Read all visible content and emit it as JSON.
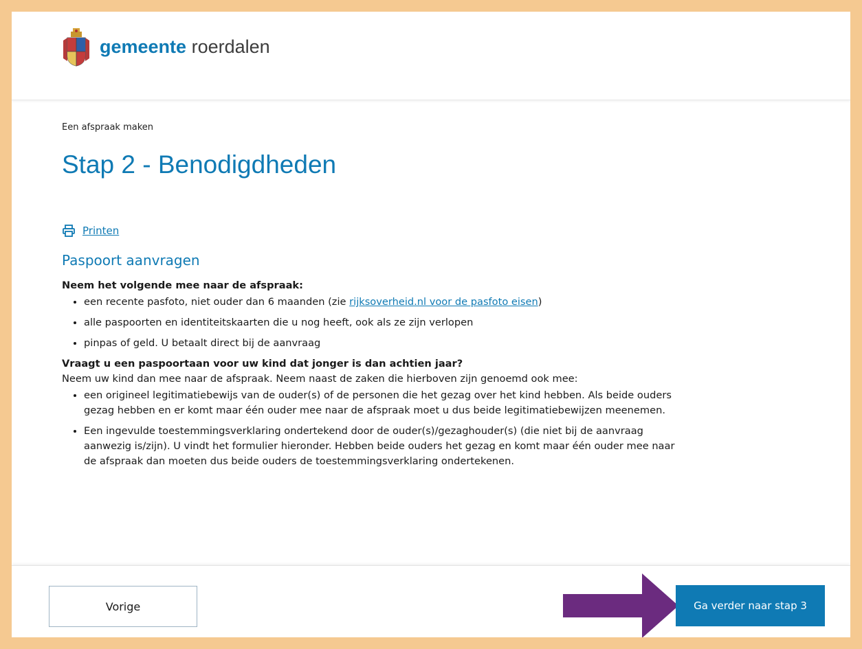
{
  "header": {
    "brand_bold": "gemeente",
    "brand_rest": "roerdalen",
    "logo_icon": "coat-of-arms-icon"
  },
  "breadcrumb": "Een afspraak maken",
  "page_title": "Stap 2 - Benodigdheden",
  "print": {
    "icon": "printer-icon",
    "label": "Printen"
  },
  "section": {
    "title": "Paspoort aanvragen",
    "intro_bold": "Neem het volgende mee naar de afspraak:",
    "items": [
      {
        "pre": "een recente pasfoto, niet ouder dan 6 maanden (zie ",
        "link": "rijksoverheid.nl voor de pasfoto eisen",
        "post": ")"
      },
      {
        "text": "alle paspoorten en identiteitskaarten die u nog heeft, ook als ze zijn verlopen"
      },
      {
        "text": "pinpas of geld. U betaalt direct bij de aanvraag"
      }
    ],
    "child_question": "Vraagt u een paspoortaan voor uw kind dat jonger is dan achtien jaar?",
    "child_intro": "Neem uw kind dan mee naar de afspraak. Neem naast de zaken die hierboven zijn genoemd ook mee:",
    "child_items": [
      "een origineel legitimatiebewijs van de ouder(s) of de personen die het gezag over het kind hebben. Als beide ouders gezag hebben en er komt maar één ouder mee naar de afspraak moet u dus beide legitimatiebewijzen meenemen.",
      "Een ingevulde toestemmingsverklaring ondertekend door de ouder(s)/gezaghouder(s) (die niet bij de aanvraag aanwezig is/zijn). U vindt het formulier hieronder. Hebben beide ouders het gezag en komt maar één ouder mee naar de afspraak dan moeten dus beide ouders de toestemmingsverklaring ondertekenen."
    ]
  },
  "footer": {
    "prev_label": "Vorige",
    "next_label": "Ga verder naar stap 3",
    "arrow_color": "#6b2b7f",
    "accent_color": "#0f7ab4"
  }
}
